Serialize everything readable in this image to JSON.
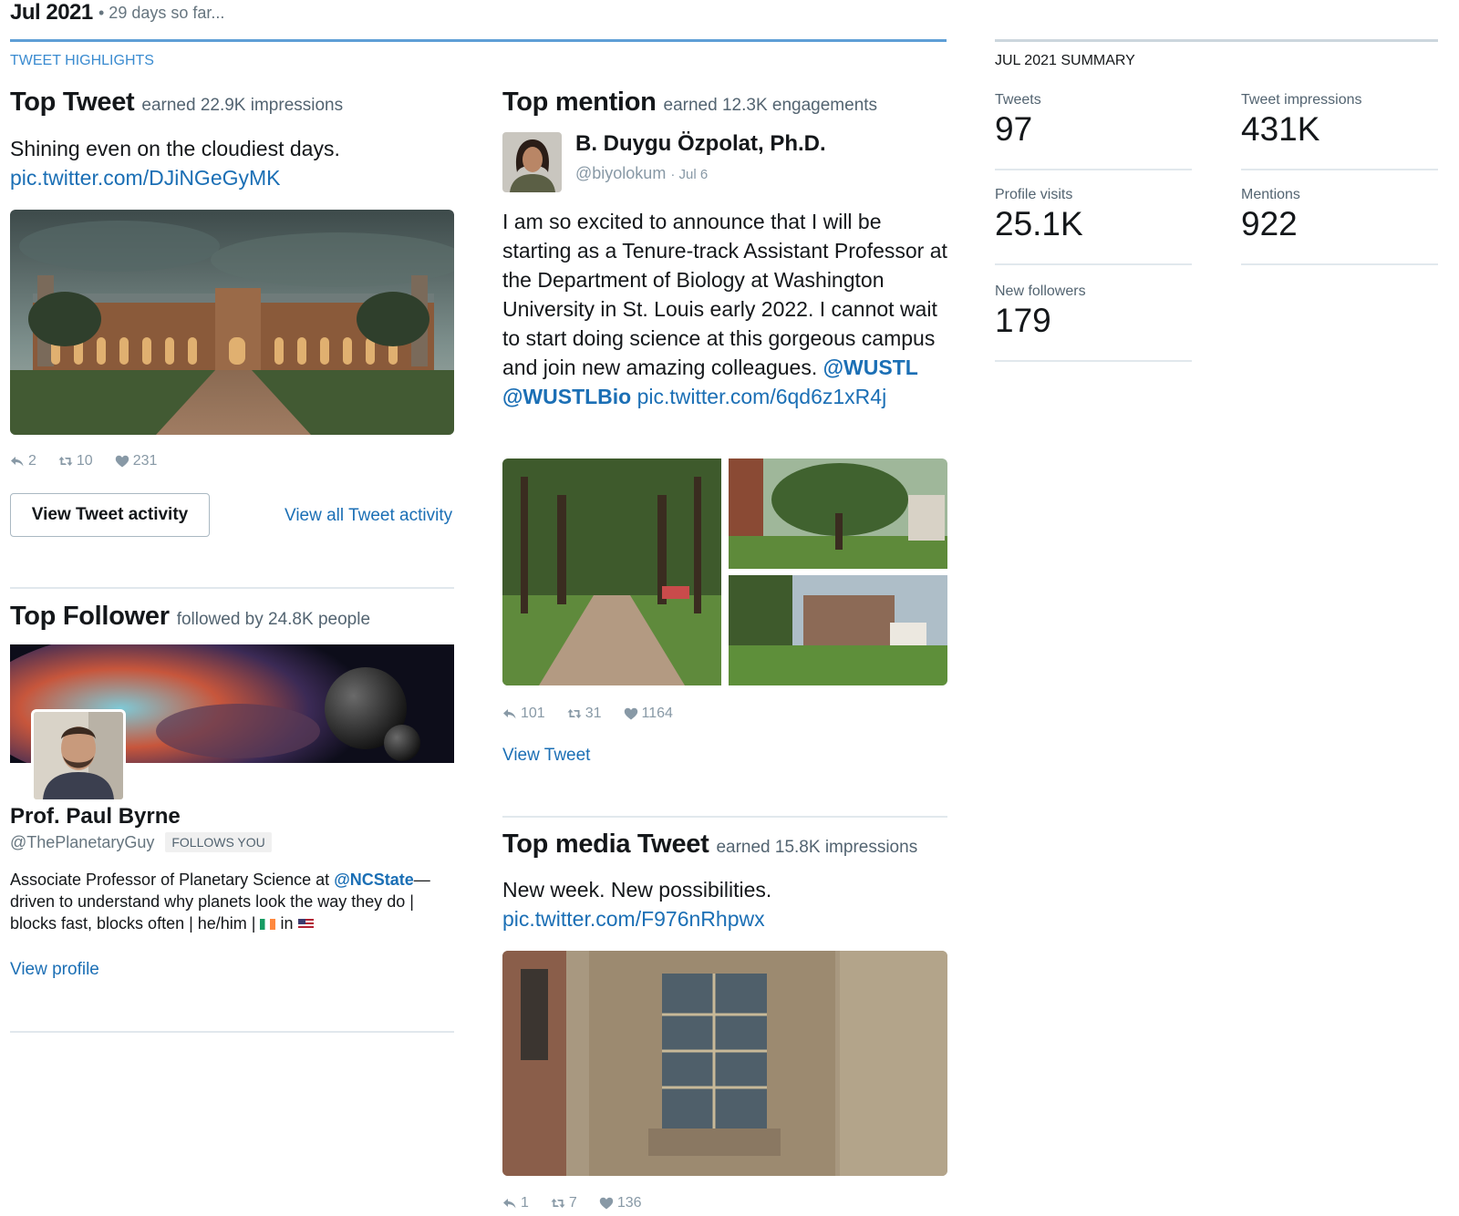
{
  "header": {
    "month": "Jul 2021",
    "days_so_far": "• 29 days so far...",
    "highlights_label": "TWEET HIGHLIGHTS",
    "summary_label": "JUL 2021 SUMMARY"
  },
  "top_tweet": {
    "title": "Top Tweet",
    "subtitle": "earned 22.9K impressions",
    "text": "Shining even on the cloudiest days.",
    "link": "pic.twitter.com/DJiNGeGyMK",
    "image_name": "university-building-photo",
    "replies": "2",
    "retweets": "10",
    "likes": "231",
    "view_activity_button": "View Tweet activity",
    "view_all_link": "View all Tweet activity"
  },
  "top_follower": {
    "title": "Top Follower",
    "subtitle": "followed by 24.8K people",
    "name": "Prof. Paul Byrne",
    "handle": "@ThePlanetaryGuy",
    "badge": "FOLLOWS YOU",
    "bio_1": "Associate Professor of Planetary Science at ",
    "bio_mention": "@NCState",
    "bio_2": "—driven to understand why planets look the way they do | blocks fast, blocks often | he/him | ",
    "bio_in": " in ",
    "view_profile": "View profile"
  },
  "top_mention": {
    "title": "Top mention",
    "subtitle": "earned 12.3K engagements",
    "name": "B. Duygu Özpolat, Ph.D.",
    "handle": "@biyolokum",
    "date": "· Jul 6",
    "text": "I am so excited to announce that I will be starting as a Tenure-track Assistant Professor at the Department of Biology at Washington University in St. Louis early 2022. I cannot wait to start doing science at this gorgeous campus and join new amazing colleagues. ",
    "mention_1": "@WUSTL",
    "mention_2": "@WUSTLBio",
    "link": "pic.twitter.com/6qd6z1xR4j",
    "replies": "101",
    "retweets": "31",
    "likes": "1164",
    "view_tweet": "View Tweet"
  },
  "top_media": {
    "title": "Top media Tweet",
    "subtitle": "earned 15.8K impressions",
    "text": "New week. New possibilities.",
    "link": "pic.twitter.com/F976nRhpwx",
    "replies": "1",
    "retweets": "7",
    "likes": "136"
  },
  "summary": {
    "tweets_label": "Tweets",
    "tweets_value": "97",
    "impressions_label": "Tweet impressions",
    "impressions_value": "431K",
    "visits_label": "Profile visits",
    "visits_value": "25.1K",
    "mentions_label": "Mentions",
    "mentions_value": "922",
    "followers_label": "New followers",
    "followers_value": "179"
  },
  "colors": {
    "link": "#1b6fb5",
    "accent_rule": "#5e9fd6",
    "muted": "#536471"
  }
}
